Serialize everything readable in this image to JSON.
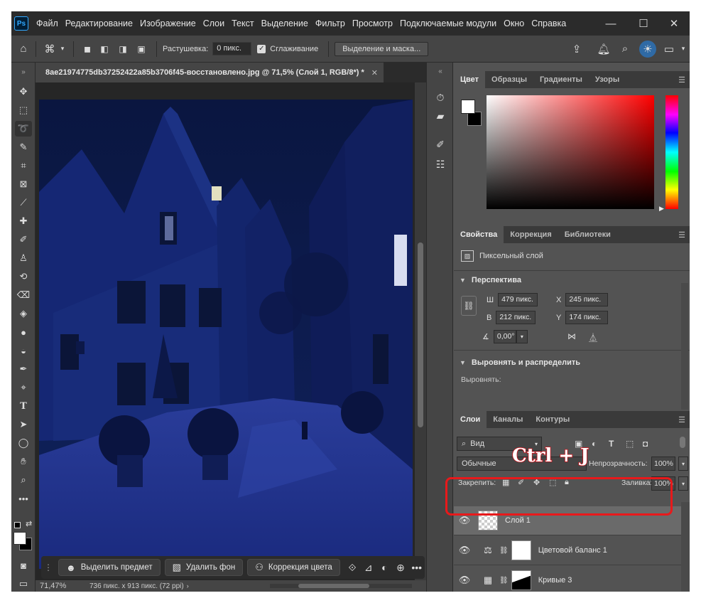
{
  "app": {
    "logo": "Ps",
    "menu": [
      "Файл",
      "Редактирование",
      "Изображение",
      "Слои",
      "Текст",
      "Выделение",
      "Фильтр",
      "Просмотр",
      "Подключаемые модули",
      "Окно",
      "Справка"
    ]
  },
  "options": {
    "feather_label": "Растушевка:",
    "feather_value": "0 пикс.",
    "antialias_label": "Сглаживание",
    "select_mask_label": "Выделение и маска..."
  },
  "document": {
    "tab_title": "8ae21974775db37252422a85b3706f45-восстановлено.jpg @ 71,5% (Слой 1, RGB/8*) *",
    "zoom": "71,47%",
    "size_info": "736 пикс. x 913 пикс. (72 ppi)"
  },
  "context_bar": {
    "select_subject": "Выделить предмет",
    "remove_bg": "Удалить фон",
    "color_correction": "Коррекция цвета"
  },
  "color_panel": {
    "tabs": [
      "Цвет",
      "Образцы",
      "Градиенты",
      "Узоры"
    ],
    "foreground": "#ffffff",
    "background": "#000000",
    "hue": "#ff0000"
  },
  "properties_panel": {
    "tabs": [
      "Свойства",
      "Коррекция",
      "Библиотеки"
    ],
    "layer_type": "Пиксельный слой",
    "perspective_title": "Перспектива",
    "w_label": "Ш",
    "w_value": "479 пикс.",
    "h_label": "В",
    "h_value": "212 пикс.",
    "x_label": "X",
    "x_value": "245 пикс.",
    "y_label": "Y",
    "y_value": "174 пикс.",
    "angle_value": "0,00°",
    "align_title": "Выровнять и распределить",
    "align_label": "Выровнять:"
  },
  "layers_panel": {
    "tabs": [
      "Слои",
      "Каналы",
      "Контуры"
    ],
    "filter_kind": "Вид",
    "blend_mode": "Обычные",
    "opacity_label": "Непрозрачность:",
    "opacity_value": "100%",
    "lock_label": "Закрепить:",
    "fill_label": "Заливка:",
    "fill_value": "100%",
    "layers": [
      {
        "name": "Слой 1"
      },
      {
        "name": "Цветовой баланс 1"
      },
      {
        "name": "Кривые 3"
      }
    ]
  },
  "annotation": {
    "hotkey": "Ctrl + J",
    "highlight_color": "#e8191b"
  }
}
